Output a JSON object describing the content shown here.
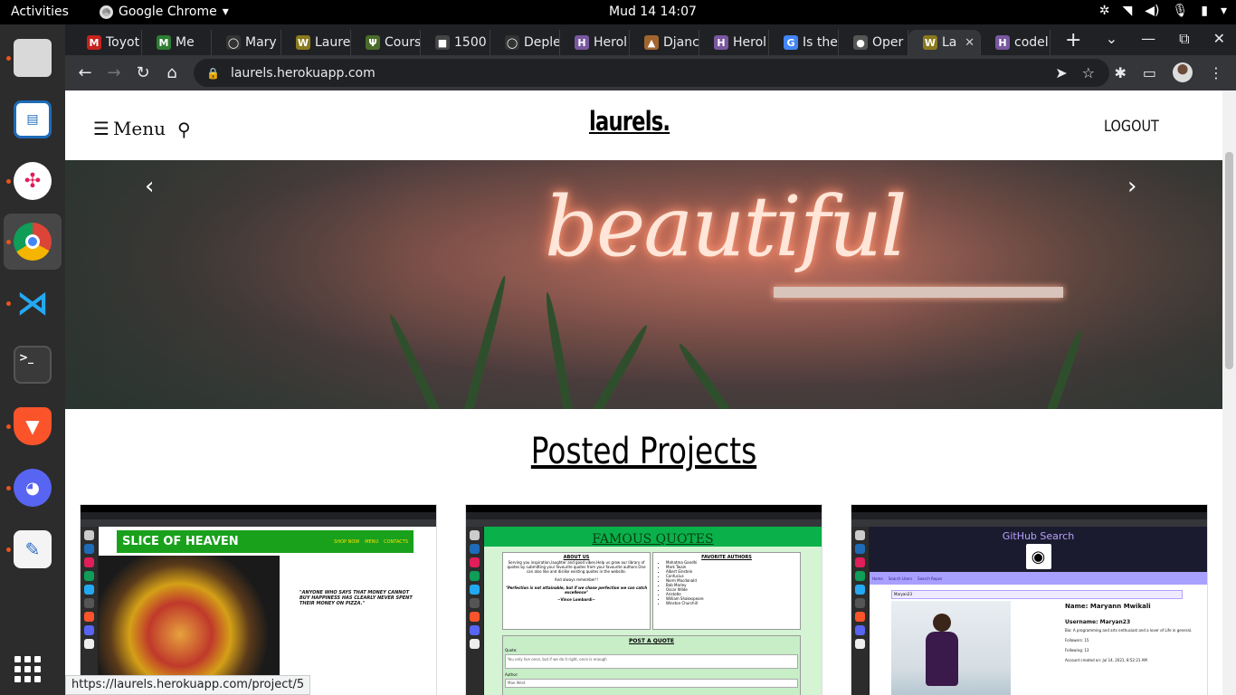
{
  "system": {
    "activities": "Activities",
    "app_name": "Google Chrome",
    "clock": "Mud 14  14:07"
  },
  "tabs": [
    {
      "title": "Toyot",
      "color": "#c5221f",
      "glyph": "M"
    },
    {
      "title": "Me",
      "color": "#2e7d32",
      "glyph": "M"
    },
    {
      "title": "Mary",
      "color": "#333",
      "glyph": "◯"
    },
    {
      "title": "Laure",
      "color": "#8a7a1e",
      "glyph": "W"
    },
    {
      "title": "Cours",
      "color": "#4a6b2a",
      "glyph": "Ψ"
    },
    {
      "title": "1500",
      "color": "#444",
      "glyph": "■"
    },
    {
      "title": "Deple",
      "color": "#333",
      "glyph": "◯"
    },
    {
      "title": "Herol",
      "color": "#79589f",
      "glyph": "H"
    },
    {
      "title": "Djanc",
      "color": "#a1662f",
      "glyph": "▲"
    },
    {
      "title": "Herol",
      "color": "#79589f",
      "glyph": "H"
    },
    {
      "title": "Is the",
      "color": "#4285f4",
      "glyph": "G"
    },
    {
      "title": "Oper",
      "color": "#555",
      "glyph": "●"
    },
    {
      "title": "La",
      "color": "#8a7a1e",
      "glyph": "W",
      "active": true
    },
    {
      "title": "codel",
      "color": "#79589f",
      "glyph": "H"
    }
  ],
  "browser": {
    "url": "laurels.herokuapp.com",
    "new_tab": "+"
  },
  "site": {
    "menu_label": "Menu",
    "brand": "laurels.",
    "logout_label": "LOGOUT",
    "hero_text": "beautiful",
    "section_title": "Posted Projects"
  },
  "projects": [
    {
      "title": "SLICE OF HEAVEN",
      "nav": [
        "SHOP NOW",
        "MENU",
        "CONTACTS"
      ],
      "quote": "\"ANYONE WHO SAYS THAT MONEY CANNOT BUY HAPPINESS HAS CLEARLY NEVER SPENT THEIR MONEY ON PIZZA.\""
    },
    {
      "title": "FAMOUS QUOTES",
      "about_heading": "ABOUT US",
      "about_text": "Serving you inspiration,laughter and good vibes.Help us grow our library of quotes by submitting your favourite quotes from your favourite authors.One can also like and dislike existing quotes in the website.",
      "remember": "And always remember!!",
      "motto": "\"Perfection is not attainable, but if we chase perfection we can catch excellence\"",
      "motto_author": "~Vince Lombardi~",
      "authors_heading": "FAVORITE AUTHORS",
      "authors": [
        "Mahatma Gandhi",
        "Mark Twain",
        "Albert Einstein",
        "Confucius",
        "Norm Macdonald",
        "Bob Marley",
        "Oscar Wilde",
        "Aristotle",
        "William Shakespeare",
        "Winston Churchill"
      ],
      "form_heading": "POST A QUOTE",
      "quote_label": "Quote:",
      "quote_value": "You only live once, but if we do it right, once is enough",
      "author_label": "Author:",
      "author_value": "Mae West"
    },
    {
      "title": "GitHub Search",
      "nav": [
        "Home",
        "Search Users",
        "Search Repos"
      ],
      "search_value": "Maryan23",
      "name": "Name: Maryann Mwikali",
      "username": "Username: Maryan23",
      "bio": "Bio: A programming and arts enthusiast and a lover of Life in general.",
      "followers": "Followers: 15",
      "following": "Following: 13",
      "created": "Account created on: Jul 14, 2021, 8:52:21 AM"
    }
  ],
  "status_url": "https://laurels.herokuapp.com/project/5"
}
